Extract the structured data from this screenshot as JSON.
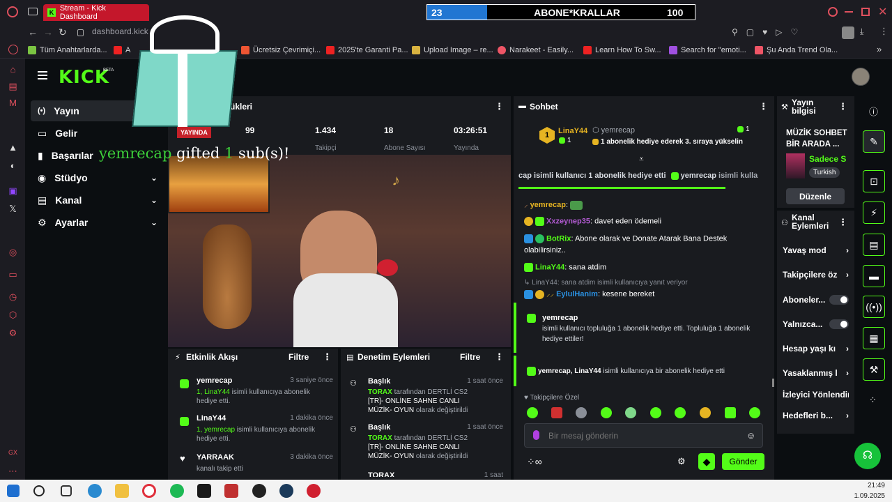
{
  "browser": {
    "tab_title": "Stream - Kick Dashboard",
    "url": "dashboard.kick",
    "bookmarks": [
      "Tüm Anahtarlarda...",
      "A",
      "Ücretsiz Çevrimiçi...",
      "2025'te Garanti Pa...",
      "Upload Image – re...",
      "Narakeet - Easily...",
      "Learn How To Sw...",
      "Search for \"emoti...",
      "Şu Anda Trend Ola..."
    ]
  },
  "overlay": {
    "sub_count": "23",
    "sub_name": "ABONE*KRALLAR",
    "sub_goal": "100",
    "gift_text_user": "yemrecap",
    "gift_text_mid": " gifted ",
    "gift_text_num": "1",
    "gift_text_end": " sub(s)!"
  },
  "nav": {
    "logo": "KICK",
    "beta": "BETA",
    "items": [
      {
        "label": "Yayın"
      },
      {
        "label": "Gelir"
      },
      {
        "label": "Başarılar"
      },
      {
        "label": "Stüdyo"
      },
      {
        "label": "Kanal"
      },
      {
        "label": "Ayarlar"
      }
    ]
  },
  "stream": {
    "header": "ükleri",
    "live_badge": "YAYINDA",
    "stats": [
      {
        "value": "99",
        "label": ""
      },
      {
        "value": "1.434",
        "label": "Takipçi"
      },
      {
        "value": "18",
        "label": "Abone Sayısı"
      },
      {
        "value": "03:26:51",
        "label": "Yayında"
      }
    ]
  },
  "events": {
    "title": "Etkinlik Akışı",
    "filter": "Filtre",
    "items": [
      {
        "user": "yemrecap",
        "time": "3 saniye önce",
        "line1a": "1, ",
        "line1b": "LinaY44",
        "line1c": " isimli kullanıcıya abonelik",
        "line2": "hediye etti."
      },
      {
        "user": "LinaY44",
        "time": "1 dakika önce",
        "line1a": "1, ",
        "line1b": "yemrecap",
        "line1c": " isimli kullanıcıya abonelik",
        "line2": "hediye etti."
      },
      {
        "user": "YARRAAK",
        "time": "3 dakika önce",
        "line1a": "",
        "line1b": "",
        "line1c": "kanalı takip etti",
        "line2": ""
      }
    ]
  },
  "moderation": {
    "title": "Denetim Eylemleri",
    "filter": "Filtre",
    "items": [
      {
        "title": "Başlık",
        "time": "1 saat önce",
        "user": "TORAX",
        "l1": " tarafından DERTLİ CS2",
        "l2": "[TR]-",
        "l2b": " ONLİNE SAHNE",
        "l2c": " CANLI",
        "l3": "MÜZİK- OYUN",
        "l3b": " olarak değiştirildi"
      },
      {
        "title": "Başlık",
        "time": "1 saat önce",
        "user": "TORAX",
        "l1": " tarafından DERTLİ CS2",
        "l2": "[TR]-",
        "l2b": " ONLİNE SAHNE",
        "l2c": " CANLI",
        "l3": "MÜZİK- OYUN",
        "l3b": " olarak değiştirildi"
      },
      {
        "title": "TORAX",
        "time": "1 saat",
        "user": "",
        "l1": "",
        "l2": "",
        "l2b": "",
        "l2c": "",
        "l3": "",
        "l3b": ""
      }
    ]
  },
  "chat": {
    "title": "Sohbet",
    "pinned_user": "LinaY44",
    "pinned_user_count": "1",
    "pinned_gifter": "yemrecap",
    "pinned_gifter_count": "1",
    "pinned_text": "1 abonelik hediye ederek 3. sıraya yükselin",
    "ticker": "cap isimli kullanıcı 1 abonelik hediye etti",
    "ticker_user": "yemrecap",
    "ticker_tail": " isimli kulla",
    "messages": [
      {
        "user": "yemrecap",
        "text": ""
      },
      {
        "user": "Xxzeynep35",
        "text": " davet eden ödemeli"
      },
      {
        "user": "BotRix",
        "text": " Abone olarak ve Donate Atarak Bana Destek",
        "text2": "olabilirsiniz.."
      },
      {
        "user": "LinaY44",
        "text": " sana atdim"
      },
      {
        "reply": "LinaY44: sana atdim isimli kullanıcıya yanıt veriyor"
      },
      {
        "user": "EylulHanim",
        "text": " kesene bereket"
      }
    ],
    "gift_card1_user": "yemrecap",
    "gift_card1_text1": "isimli kullanıcı topluluğa 1 abonelik hediye etti. Topluluğa 1 abonelik",
    "gift_card1_text2": "hediye ettiler!",
    "gift_card2_users": "yemrecap, LinaY44",
    "gift_card2_text": " isimli kullanıcıya bir abonelik hediye etti",
    "follower_only": "Takipçilere Özel",
    "input_placeholder": "Bir mesaj gönderin",
    "send": "Gönder"
  },
  "stream_info": {
    "title": "Yayın bilgisi",
    "stream_title": "MÜZİK SOHBET BİR ARADA ...",
    "category": "Sadece S",
    "language": "Turkish",
    "edit": "Düzenle"
  },
  "channel_actions": {
    "title": "Kanal Eylemleri",
    "items": [
      {
        "label": "Yavaş mod",
        "kind": "arrow"
      },
      {
        "label": "Takipçilere öz",
        "kind": "arrow"
      },
      {
        "label": "Aboneler...",
        "kind": "toggle"
      },
      {
        "label": "Yalnızca...",
        "kind": "toggle"
      },
      {
        "label": "Hesap yaşı kı",
        "kind": "arrow"
      },
      {
        "label": "Yasaklanmış l",
        "kind": "arrow"
      },
      {
        "label": "İzleyici Yönlendir",
        "kind": "none"
      },
      {
        "label": "Hedefleri b...",
        "kind": "arrow"
      }
    ]
  },
  "taskbar": {
    "time": "21:49",
    "date": "1.09.2025"
  },
  "colors": {
    "kick_green": "#53fc18",
    "panel": "#191b1f",
    "bg": "#0b0e11",
    "tab_red": "#c4172b"
  }
}
